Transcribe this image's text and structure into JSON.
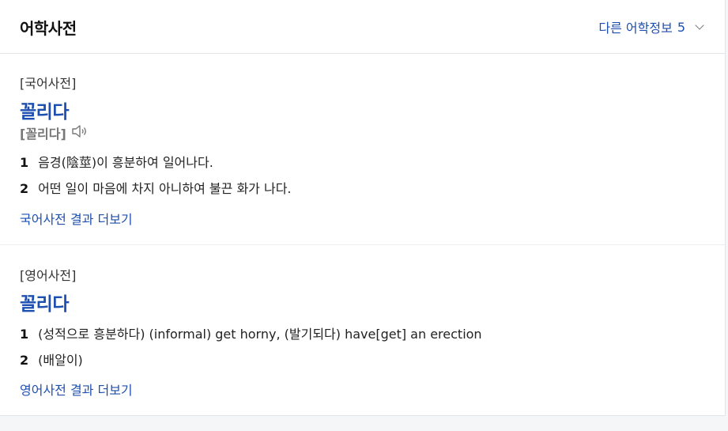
{
  "header": {
    "title": "어학사전",
    "more_info_label": "다른 어학정보",
    "more_info_count": "5"
  },
  "korean_dict": {
    "source": "[국어사전]",
    "headword": "꼴리다",
    "pronunciation": "[꼴리다]",
    "definitions": [
      {
        "num": "1",
        "text": "음경(陰莖)이 흥분하여 일어나다."
      },
      {
        "num": "2",
        "text": "어떤 일이 마음에 차지 아니하여 불끈 화가 나다."
      }
    ],
    "more_link": "국어사전 결과 더보기"
  },
  "english_dict": {
    "source": "[영어사전]",
    "headword": "꼴리다",
    "definitions": [
      {
        "num": "1",
        "text": "(성적으로 흥분하다) (informal) get horny, (발기되다) have[get] an erection"
      },
      {
        "num": "2",
        "text": "(배알이)"
      }
    ],
    "more_link": "영어사전 결과 더보기"
  },
  "icons": {
    "speaker": "speaker-icon",
    "chevron": "chevron-down-icon"
  },
  "colors": {
    "link_blue": "#1d4fb0",
    "background": "#f5f6f8"
  }
}
